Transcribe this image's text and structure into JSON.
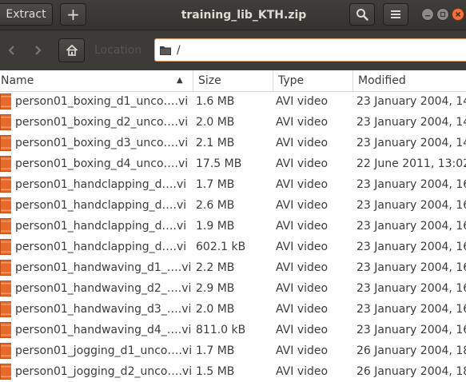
{
  "header": {
    "extract_label": "Extract",
    "add_label": "+",
    "title": "training_lib_KTH.zip"
  },
  "toolbar": {
    "location_label": "Location",
    "path": "/"
  },
  "columns": {
    "name": "Name",
    "size": "Size",
    "type": "Type",
    "modified": "Modified"
  },
  "files": [
    {
      "name": "person01_boxing_d1_uncomp.avi",
      "size": "1.6 MB",
      "type": "AVI video",
      "modified": "23 January 2004, 14:"
    },
    {
      "name": "person01_boxing_d2_uncomp.avi",
      "size": "2.0 MB",
      "type": "AVI video",
      "modified": "23 January 2004, 14:"
    },
    {
      "name": "person01_boxing_d3_uncomp.avi",
      "size": "2.1 MB",
      "type": "AVI video",
      "modified": "23 January 2004, 14:"
    },
    {
      "name": "person01_boxing_d4_uncomp.avi",
      "size": "17.5 MB",
      "type": "AVI video",
      "modified": "22 June 2011, 13:02"
    },
    {
      "name": "person01_handclapping_d1_uncomp.avi",
      "size": "1.7 MB",
      "type": "AVI video",
      "modified": "23 January 2004, 16:"
    },
    {
      "name": "person01_handclapping_d2_uncomp.avi",
      "size": "2.6 MB",
      "type": "AVI video",
      "modified": "23 January 2004, 16:"
    },
    {
      "name": "person01_handclapping_d3_uncomp.avi",
      "size": "1.9 MB",
      "type": "AVI video",
      "modified": "23 January 2004, 16:"
    },
    {
      "name": "person01_handclapping_d4_uncomp.avi",
      "size": "602.1 kB",
      "type": "AVI video",
      "modified": "23 January 2004, 16:"
    },
    {
      "name": "person01_handwaving_d1_uncomp.avi",
      "size": "2.2 MB",
      "type": "AVI video",
      "modified": "23 January 2004, 16:"
    },
    {
      "name": "person01_handwaving_d2_uncomp.avi",
      "size": "2.9 MB",
      "type": "AVI video",
      "modified": "23 January 2004, 16:"
    },
    {
      "name": "person01_handwaving_d3_uncomp.avi",
      "size": "2.0 MB",
      "type": "AVI video",
      "modified": "23 January 2004, 16:"
    },
    {
      "name": "person01_handwaving_d4_uncomp.avi",
      "size": "811.0 kB",
      "type": "AVI video",
      "modified": "23 January 2004, 16:"
    },
    {
      "name": "person01_jogging_d1_uncomp.avi",
      "size": "1.7 MB",
      "type": "AVI video",
      "modified": "26 January 2004, 18:"
    },
    {
      "name": "person01_jogging_d2_uncomp.avi",
      "size": "1.5 MB",
      "type": "AVI video",
      "modified": "26 January 2004, 18:"
    }
  ],
  "colors": {
    "headerbar": "#3c3b37",
    "accent": "#f0703f",
    "file_icon": "#e8692c"
  }
}
